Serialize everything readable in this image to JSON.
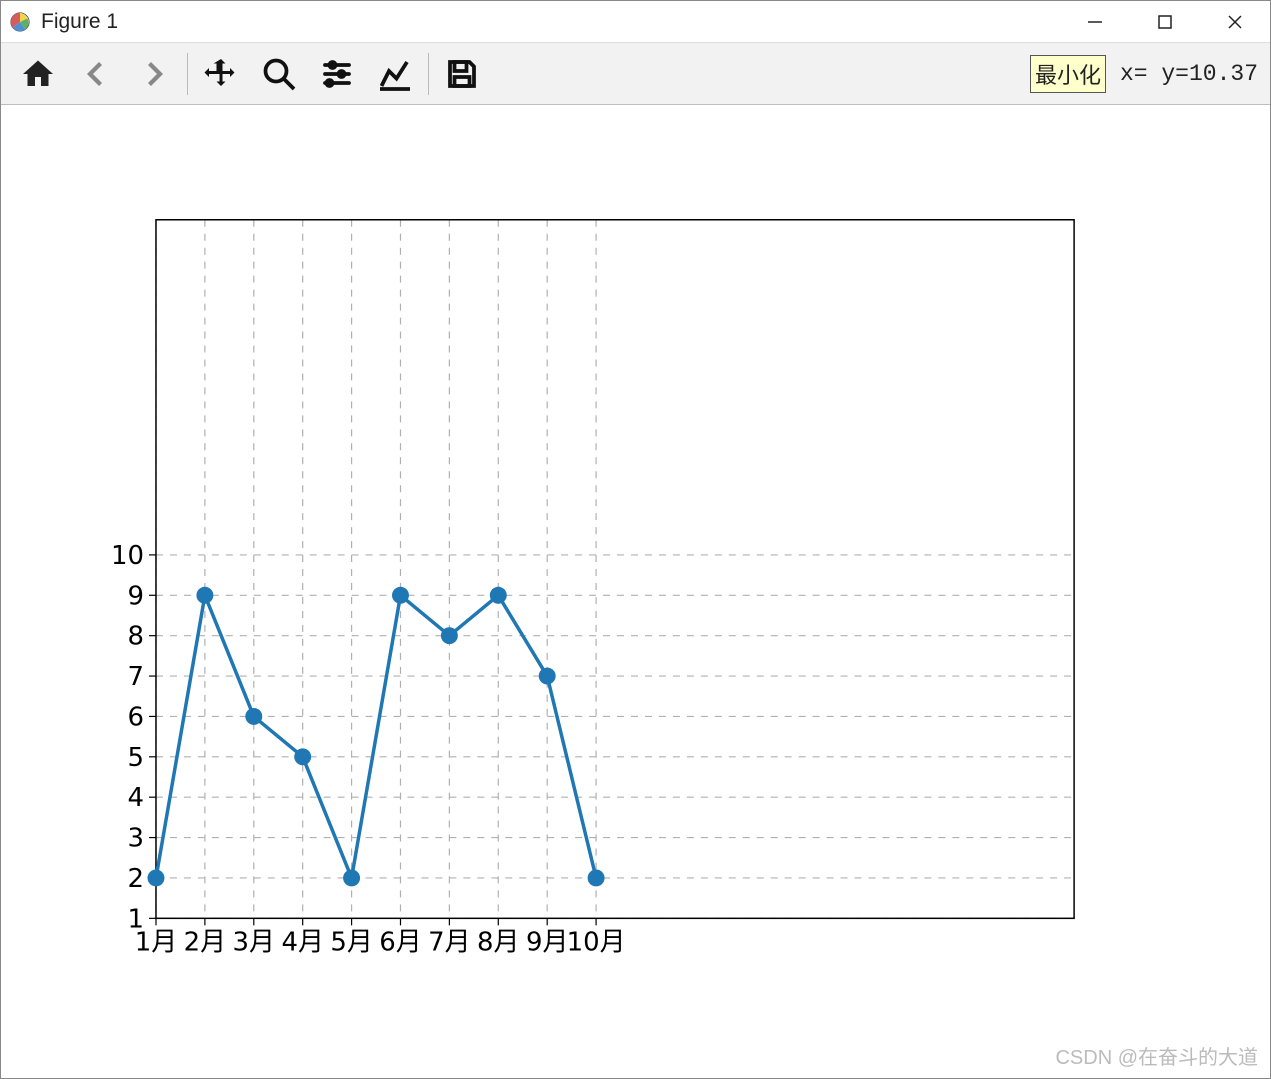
{
  "window": {
    "title": "Figure 1"
  },
  "toolbar": {
    "tooltip": "最小化",
    "coord_text": "x=  y=10.37"
  },
  "watermark": "CSDN @在奋斗的大道",
  "chart_data": {
    "type": "line",
    "categories": [
      "1月",
      "2月",
      "3月",
      "4月",
      "5月",
      "6月",
      "7月",
      "8月",
      "9月",
      "10月"
    ],
    "values": [
      2,
      9,
      6,
      5,
      2,
      9,
      8,
      9,
      7,
      2
    ],
    "y_ticks": [
      1,
      2,
      3,
      4,
      5,
      6,
      7,
      8,
      9,
      10
    ],
    "ylim": [
      1,
      null
    ],
    "xlabel": "",
    "ylabel": "",
    "title": "",
    "grid": true,
    "marker": "o",
    "line_color": "#1f77b4"
  }
}
